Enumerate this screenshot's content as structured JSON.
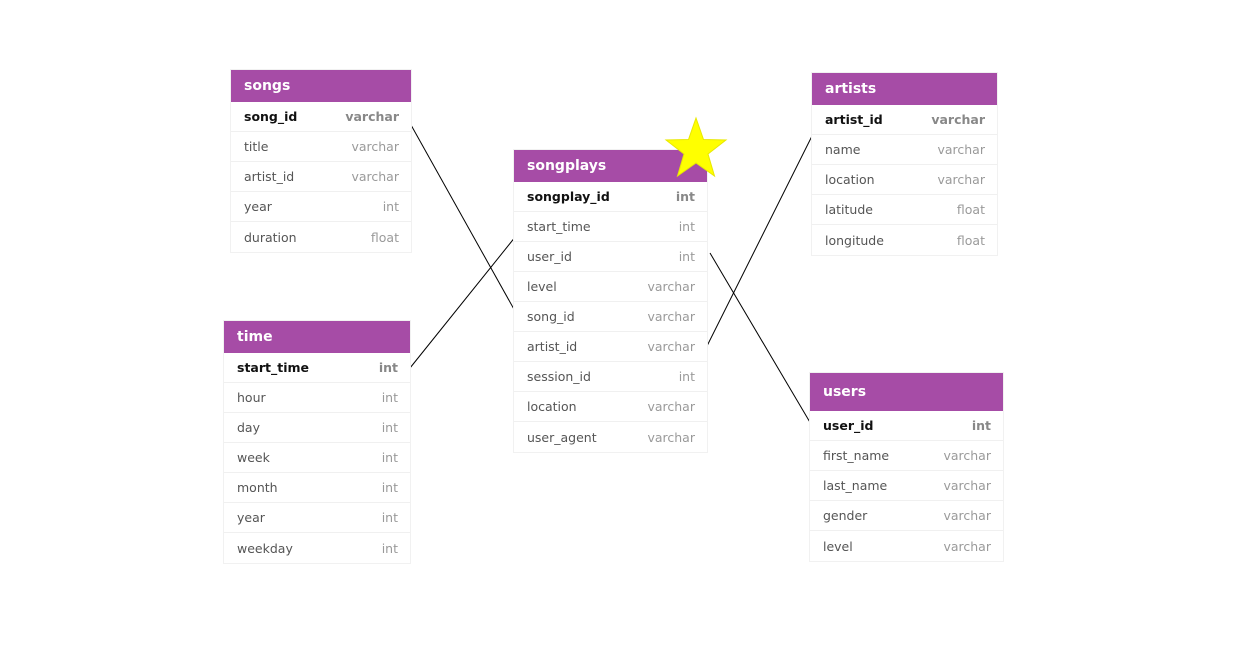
{
  "tables": {
    "songs": {
      "title": "songs",
      "columns": [
        {
          "name": "song_id",
          "type": "varchar"
        },
        {
          "name": "title",
          "type": "varchar"
        },
        {
          "name": "artist_id",
          "type": "varchar"
        },
        {
          "name": "year",
          "type": "int"
        },
        {
          "name": "duration",
          "type": "float"
        }
      ]
    },
    "time": {
      "title": "time",
      "columns": [
        {
          "name": "start_time",
          "type": "int"
        },
        {
          "name": "hour",
          "type": "int"
        },
        {
          "name": "day",
          "type": "int"
        },
        {
          "name": "week",
          "type": "int"
        },
        {
          "name": "month",
          "type": "int"
        },
        {
          "name": "year",
          "type": "int"
        },
        {
          "name": "weekday",
          "type": "int"
        }
      ]
    },
    "songplays": {
      "title": "songplays",
      "columns": [
        {
          "name": "songplay_id",
          "type": "int"
        },
        {
          "name": "start_time",
          "type": "int"
        },
        {
          "name": "user_id",
          "type": "int"
        },
        {
          "name": "level",
          "type": "varchar"
        },
        {
          "name": "song_id",
          "type": "varchar"
        },
        {
          "name": "artist_id",
          "type": "varchar"
        },
        {
          "name": "session_id",
          "type": "int"
        },
        {
          "name": "location",
          "type": "varchar"
        },
        {
          "name": "user_agent",
          "type": "varchar"
        }
      ]
    },
    "artists": {
      "title": "artists",
      "columns": [
        {
          "name": "artist_id",
          "type": "varchar"
        },
        {
          "name": "name",
          "type": "varchar"
        },
        {
          "name": "location",
          "type": "varchar"
        },
        {
          "name": "latitude",
          "type": "float"
        },
        {
          "name": "longitude",
          "type": "float"
        }
      ]
    },
    "users": {
      "title": "users",
      "columns": [
        {
          "name": "user_id",
          "type": "int"
        },
        {
          "name": "first_name",
          "type": "varchar"
        },
        {
          "name": "last_name",
          "type": "varchar"
        },
        {
          "name": "gender",
          "type": "varchar"
        },
        {
          "name": "level",
          "type": "varchar"
        }
      ]
    }
  },
  "relations": [
    {
      "from": "songs.song_id",
      "to": "songplays.song_id"
    },
    {
      "from": "time.start_time",
      "to": "songplays.start_time"
    },
    {
      "from": "artists.artist_id",
      "to": "songplays.artist_id"
    },
    {
      "from": "users.user_id",
      "to": "songplays.user_id"
    }
  ],
  "colors": {
    "header": "#a64ca6",
    "star": "#ffff00",
    "link": "#000000"
  },
  "icons": {
    "fact_marker": "star-icon"
  }
}
